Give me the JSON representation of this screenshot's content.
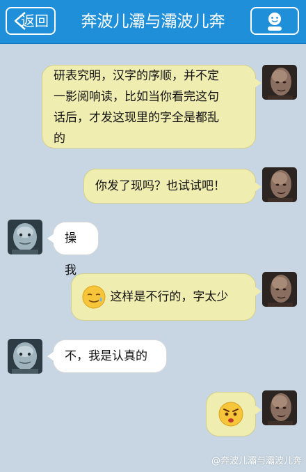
{
  "header": {
    "back_label": "返回",
    "title": "奔波儿灞与灞波儿奔",
    "profile_icon": "profile-smiley-icon"
  },
  "colors": {
    "header": "#1f8fd9",
    "background": "#c7d6e2",
    "my_bubble": "#f0edb0",
    "their_bubble": "#ffffff"
  },
  "messages": [
    {
      "sender": "me",
      "lines": [
        "研表究明，汉字的序顺，并不定",
        "一影阅响读，比如当你看完这句",
        "话后，才发这现里的字全是都乱",
        "的"
      ]
    },
    {
      "sender": "me",
      "lines": [
        "你发了现吗？也试试吧！"
      ]
    },
    {
      "sender": "them",
      "lines": [
        "操我"
      ]
    },
    {
      "sender": "me",
      "emoji": "sweat-smile-emoji",
      "lines": [
        "这样是不行的，字太少"
      ]
    },
    {
      "sender": "them",
      "lines": [
        "不，我是认真的"
      ]
    },
    {
      "sender": "me",
      "emoji": "angry-emoji",
      "lines": []
    }
  ],
  "watermark": "@奔波儿灞与灞波儿奔"
}
